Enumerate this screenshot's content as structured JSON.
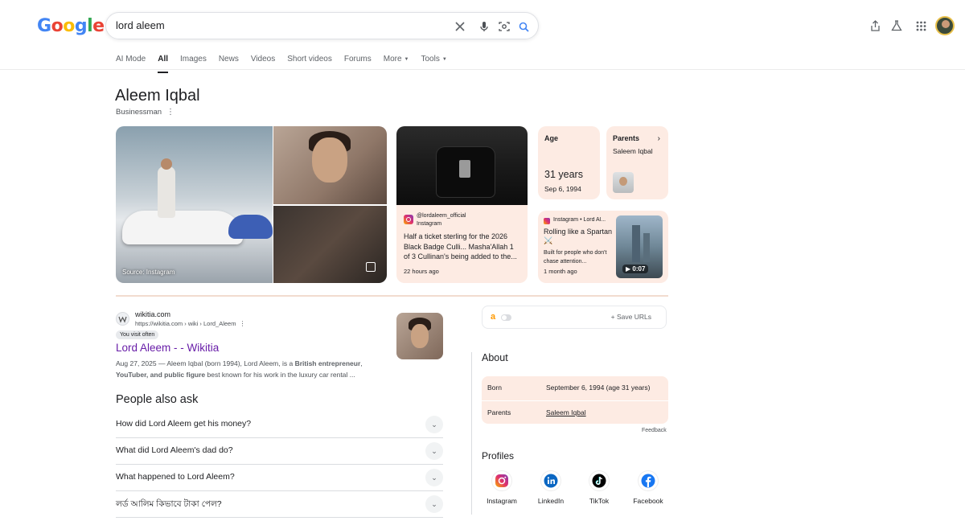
{
  "header": {
    "logo_letters": [
      "G",
      "o",
      "o",
      "g",
      "l",
      "e"
    ],
    "logo_colors": [
      "#4285F4",
      "#EA4335",
      "#FBBC05",
      "#4285F4",
      "#34A853",
      "#EA4335"
    ],
    "query": "lord aleem"
  },
  "tabs": [
    {
      "label": "AI Mode"
    },
    {
      "label": "All"
    },
    {
      "label": "Images"
    },
    {
      "label": "News"
    },
    {
      "label": "Videos"
    },
    {
      "label": "Short videos"
    },
    {
      "label": "Forums"
    },
    {
      "label": "More"
    },
    {
      "label": "Tools"
    }
  ],
  "active_tab": "All",
  "entity": {
    "name": "Aleem Iqbal",
    "subtitle": "Businessman",
    "photo_source": "Source: Instagram",
    "instagram_post": {
      "handle": "@lordaleem_official",
      "platform": "Instagram",
      "text": "Half a ticket sterling for the 2026 Black Badge Culli... Masha'Allah 1 of 3 Cullinan's being added to the...",
      "time": "22 hours ago"
    },
    "age": {
      "label": "Age",
      "value": "31 years",
      "date": "Sep 6, 1994"
    },
    "parents": {
      "label": "Parents",
      "name": "Saleem Iqbal"
    },
    "reel": {
      "source": "Instagram • Lord Al...",
      "title": "Rolling like a Spartan ⚔️",
      "desc": "Built for people who don't chase attention...",
      "time": "1 month ago",
      "duration": "0:07"
    }
  },
  "result": {
    "site": "wikitia.com",
    "url": "https://wikitia.com › wiki › Lord_Aleem",
    "badge": "You visit often",
    "title": "Lord Aleem - - Wikitia",
    "date": "Aug 27, 2025",
    "snippet_a": " — Aleem Iqbal (born 1994), Lord Aleem, is a ",
    "snippet_b1": "British entrepreneur",
    "snippet_c": ", ",
    "snippet_b2": "YouTuber, and public figure",
    "snippet_d": " best known for his work in the luxury car rental ..."
  },
  "paa": {
    "title": "People also ask",
    "questions": [
      "How did Lord Aleem get his money?",
      "What did Lord Aleem's dad do?",
      "What happened to Lord Aleem?",
      "লর্ড আলিম কিভাবে টাকা পেল?"
    ]
  },
  "side": {
    "save_urls": "Save URLs",
    "about_title": "About",
    "born_label": "Born",
    "born_value": "September 6, 1994 (age 31 years)",
    "parents_label": "Parents",
    "parents_value": "Saleem Iqbal",
    "feedback": "Feedback",
    "profiles_title": "Profiles",
    "profiles": [
      "Instagram",
      "LinkedIn",
      "TikTok",
      "Facebook"
    ]
  }
}
